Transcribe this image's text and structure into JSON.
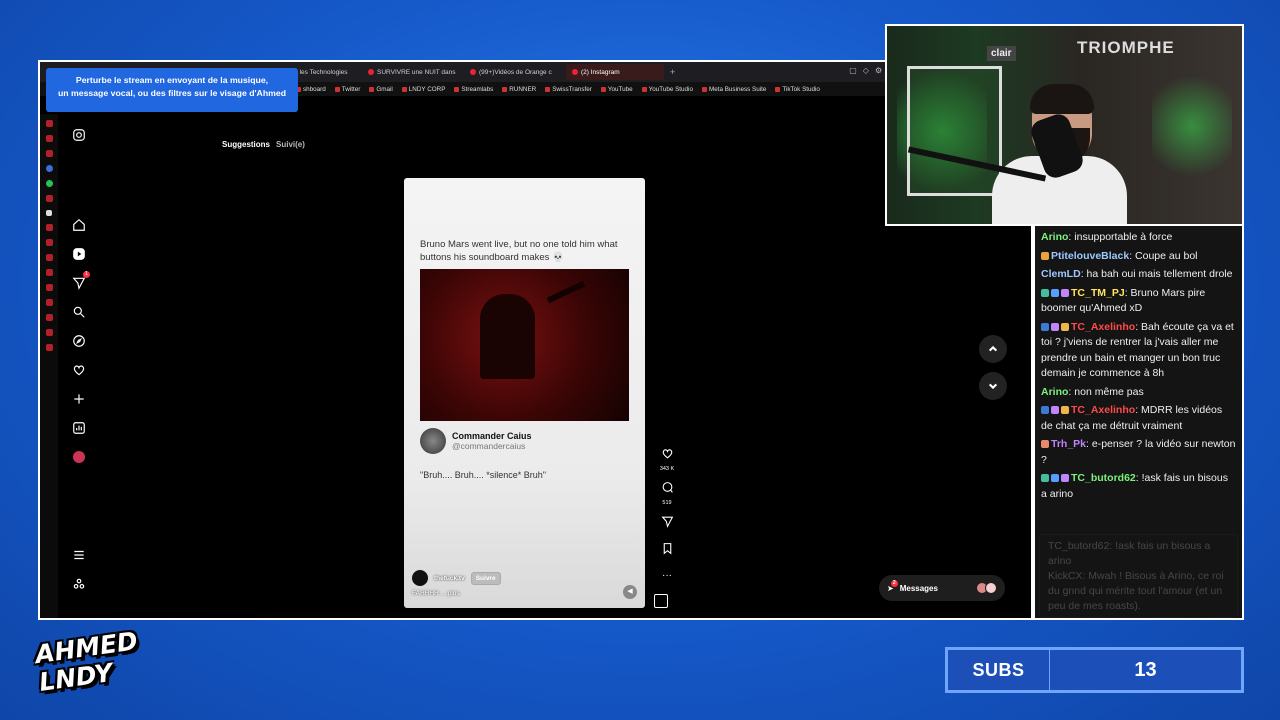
{
  "overlay": {
    "promo_line1": "Perturbe le stream en envoyant de la musique,",
    "promo_line2": "un message vocal, ou des filtres sur le visage d'Ahmed",
    "logo_line1": "AHMED",
    "logo_line2": "LNDY",
    "subs_label": "SUBS",
    "subs_value": "13",
    "webcam_sign": "TRIOMPHE",
    "webcam_brand": "clair"
  },
  "browser": {
    "tabs": [
      {
        "label": "Je teste les Technologies",
        "active": false
      },
      {
        "label": "SURVIVRE une NUIT dans",
        "active": false
      },
      {
        "label": "(99+)Vidéos de Orange c",
        "active": false
      },
      {
        "label": "(2) Instagram",
        "active": true
      }
    ],
    "new_tab": "+",
    "bookmarks": [
      "shboard",
      "Twitter",
      "Gmail",
      "LNDY CORP",
      "Streamlabs",
      "RUNNER",
      "SwissTransfer",
      "YouTube",
      "YouTube Studio",
      "Meta Business Suite",
      "TikTok Studio"
    ]
  },
  "instagram": {
    "nav_notification_count": "1",
    "subtab_active": "Suggestions",
    "subtab_inactive": "Suivi(e)",
    "reel": {
      "caption": "Bruno Mars went live, but no one told him what buttons his soundboard makes 💀",
      "author_name": "Commander Caius",
      "author_handle": "@commandercaius",
      "quote": "\"Bruh.... Bruh.... *silence* Bruh\"",
      "account": "thefuck.tv",
      "follow_label": "Suivre",
      "subtitle": "FAHHHH ... plus",
      "likes": "343 K",
      "comments": "519"
    },
    "messages_label": "Messages",
    "messages_count": "2"
  },
  "chat": {
    "messages": [
      {
        "user": "Arino",
        "color": "#7cf27c",
        "text": "insupportable à force",
        "badges": []
      },
      {
        "user": "PtitelouveBlack",
        "color": "#9ec8ff",
        "text": "Coupe au bol",
        "badges": [
          "#e8a33a"
        ]
      },
      {
        "user": "ClemLD",
        "color": "#9ec8ff",
        "text": "ha bah oui mais tellement drole",
        "badges": []
      },
      {
        "user": "TC_TM_PJ",
        "color": "#ffe45c",
        "text": "Bruno Mars pire boomer qu'Ahmed xD",
        "badges": [
          "#3fbf9f",
          "#54a0ff",
          "#c084fc"
        ]
      },
      {
        "user": "TC_Axelinho",
        "color": "#ff4a4a",
        "text": "Bah écoute ça va et toi ? j'viens de rentrer la j'vais aller me prendre un bain et manger un bon truc demain je commence à 8h",
        "badges": [
          "#3a7bd5",
          "#c084fc",
          "#f0b64a"
        ]
      },
      {
        "user": "Arino",
        "color": "#7cf27c",
        "text": "non même pas",
        "badges": []
      },
      {
        "user": "TC_Axelinho",
        "color": "#ff4a4a",
        "text": "MDRR les vidéos de chat ça me détruit vraiment",
        "badges": [
          "#3a7bd5",
          "#c084fc",
          "#f0b64a"
        ]
      },
      {
        "user": "Trh_Pk",
        "color": "#c084fc",
        "text": "e-penser ? la vidéo sur newton ?",
        "badges": [
          "#e88a6a"
        ]
      },
      {
        "user": "TC_butord62",
        "color": "#7cf27c",
        "text": "!ask fais un bisous a arino",
        "badges": [
          "#3fbf9f",
          "#54a0ff",
          "#c084fc"
        ]
      }
    ],
    "faded_user": "TC_butord62",
    "faded_text": "!ask fais un bisous a arino",
    "faded_user2": "KickCX",
    "faded_text2": "Mwah ! Bisous à Arino, ce roi du gnnd qui mérite tout l'amour (et un peu de mes roasts)."
  }
}
